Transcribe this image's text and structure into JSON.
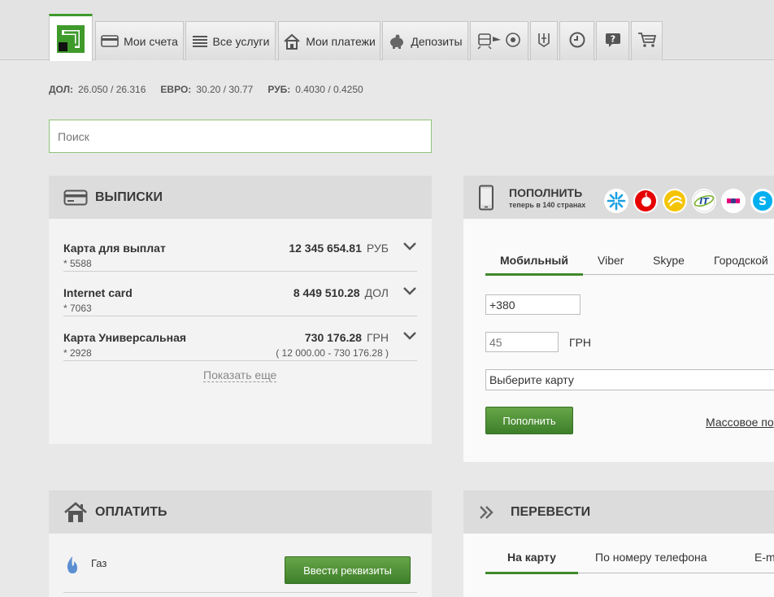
{
  "nav": {
    "tabs": [
      {
        "label": "Мои счета",
        "icon": "card-icon"
      },
      {
        "label": "Все услуги",
        "icon": "list-icon"
      },
      {
        "label": "Мои платежи",
        "icon": "house-icon"
      },
      {
        "label": "Депозиты",
        "icon": "piggy-bank-icon"
      }
    ],
    "icon_tabs": [
      "travel-icon",
      "ukraine-trident-icon",
      "history-icon",
      "help-icon",
      "cart-icon"
    ]
  },
  "rates": [
    {
      "label": "ДОЛ:",
      "value": "26.050 / 26.316"
    },
    {
      "label": "ЕВРО:",
      "value": "30.20 / 30.77"
    },
    {
      "label": "РУБ:",
      "value": "0.4030 / 0.4250"
    }
  ],
  "search": {
    "placeholder": "Поиск"
  },
  "statements": {
    "title": "ВЫПИСКИ",
    "rows": [
      {
        "name": "Карта для выплат",
        "number": "* 5588",
        "amount": "12 345 654.81",
        "currency": "РУБ",
        "limit": ""
      },
      {
        "name": "Internet card",
        "number": "* 7063",
        "amount": "8 449 510.28",
        "currency": "ДОЛ",
        "limit": ""
      },
      {
        "name": "Карта Универсальная",
        "number": "* 2928",
        "amount": "730 176.28",
        "currency": "ГРН",
        "limit": "( 12 000.00 - 730 176.28 )"
      }
    ],
    "show_more": "Показать еще"
  },
  "topup": {
    "title": "ПОПОЛНИТЬ",
    "subtitle": "теперь в 140 странах",
    "tabs": [
      "Мобильный",
      "Viber",
      "Skype",
      "Городской"
    ],
    "phone_value": "+380",
    "amount_placeholder": "45",
    "currency": "ГРН",
    "card_select": "Выберите карту",
    "button": "Пополнить",
    "mass_link": "Массовое по"
  },
  "pay": {
    "title": "ОПЛАТИТЬ",
    "item": "Газ",
    "button": "Ввести реквизиты"
  },
  "transfer": {
    "title": "ПЕРЕВЕСТИ",
    "tabs": [
      "На карту",
      "По номеру телефона",
      "E-m"
    ]
  },
  "colors": {
    "accent": "#3f8a2a",
    "header_bg": "#dcdcdc",
    "panel_bg": "#f3f3f3"
  }
}
